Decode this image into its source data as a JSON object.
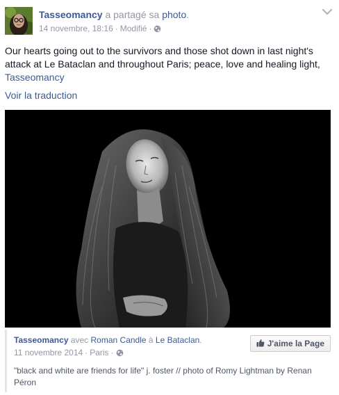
{
  "post": {
    "author": "Tasseomancy",
    "action_text": " a partagé sa ",
    "action_link": "photo",
    "action_end": ".",
    "timestamp": "14 novembre, 18:16",
    "separator": "·",
    "edited": "Modifié",
    "message": "Our hearts going out to the survivors and those shot down in last night's attack at Le Bataclan and throughout Paris; peace, love and healing light, ",
    "message_tag": "Tasseomancy",
    "translate_label": "Voir la traduction"
  },
  "attachment": {
    "author": "Tasseomancy",
    "with_text": " avec ",
    "with_person": "Roman Candle",
    "at_text": " à ",
    "place": "Le Bataclan",
    "end": ".",
    "date": "11 novembre 2014",
    "location": "Paris",
    "separator": "·",
    "like_button_label": "J'aime la Page",
    "caption": "\"black and white are friends for life\" j. foster // photo of Romy Lightman by Renan Péron"
  },
  "icons": {
    "globe": "globe-icon",
    "chevron": "chevron-down-icon",
    "thumbs_up": "thumbs-up-icon"
  },
  "colors": {
    "link": "#3b5998",
    "meta": "#9197a3",
    "text": "#141823"
  }
}
